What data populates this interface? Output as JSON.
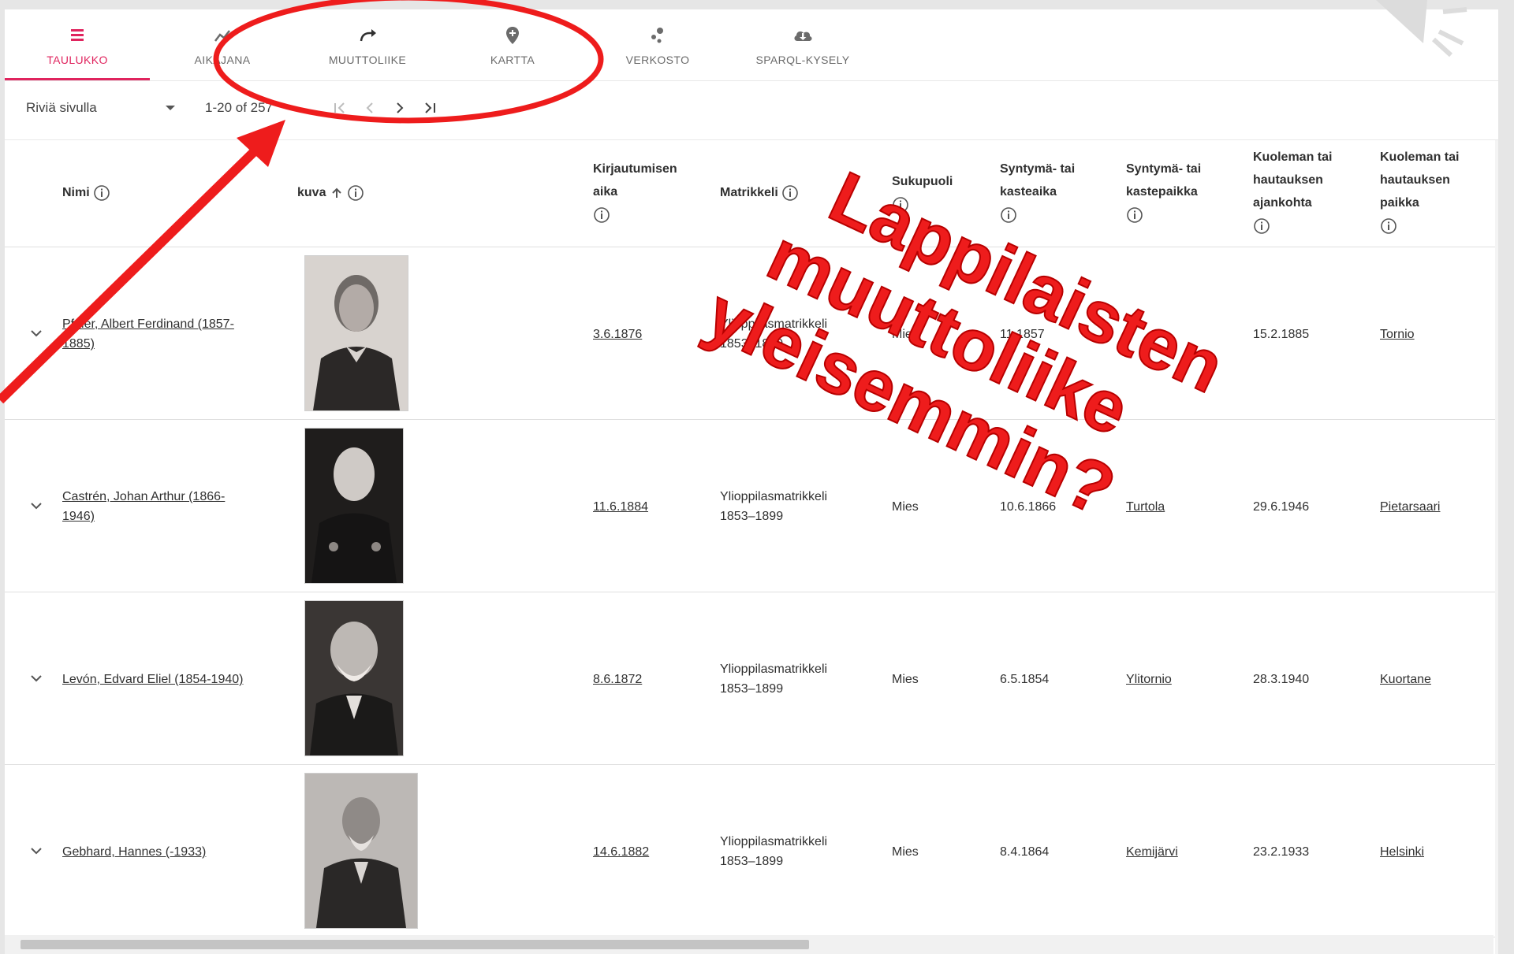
{
  "tabs": [
    {
      "label": "TAULUKKO",
      "icon": "table-icon",
      "active": true
    },
    {
      "label": "AIKAJANA",
      "icon": "timeline-icon",
      "active": false
    },
    {
      "label": "MUUTTOLIIKE",
      "icon": "redo-arrow-icon",
      "active": false
    },
    {
      "label": "KARTTA",
      "icon": "map-pin-plus-icon",
      "active": false
    },
    {
      "label": "VERKOSTO",
      "icon": "network-icon",
      "active": false
    },
    {
      "label": "SPARQL-KYSELY",
      "icon": "cloud-download-icon",
      "active": false
    }
  ],
  "pager": {
    "rows_label": "Riviä sivulla",
    "range": "1-20 of 257"
  },
  "headers": {
    "nimi": "Nimi",
    "kuva": "kuva",
    "kirjautumisen_1": "Kirjautumisen",
    "kirjautumisen_2": "aika",
    "matrikkeli": "Matrikkeli",
    "sukupuoli": "Sukupuoli",
    "syntyma_aika_1": "Syntymä- tai",
    "syntyma_aika_2": "kasteaika",
    "syntyma_paikka_1": "Syntymä- tai",
    "syntyma_paikka_2": "kastepaikka",
    "kuolema_aika_1": "Kuoleman tai",
    "kuolema_aika_2": "hautauksen",
    "kuolema_aika_3": "ajankohta",
    "kuolema_paikka_1": "Kuoleman tai",
    "kuolema_paikka_2": "hautauksen",
    "kuolema_paikka_3": "paikka"
  },
  "rows": [
    {
      "name_1": "Pfaler, Albert Ferdinand (1857-",
      "name_2": "1885)",
      "date": "3.6.1876",
      "matrikkeli_1": "Ylioppilasmatrikkeli",
      "matrikkeli_2": "1853–1899",
      "gender": "Mies",
      "birth": "11.1857",
      "birthplace": "",
      "death": "15.2.1885",
      "deathplace": "Tornio"
    },
    {
      "name_1": "Castrén, Johan Arthur (1866-",
      "name_2": "1946)",
      "date": "11.6.1884",
      "matrikkeli_1": "Ylioppilasmatrikkeli",
      "matrikkeli_2": "1853–1899",
      "gender": "Mies",
      "birth": "10.6.1866",
      "birthplace": "Turtola",
      "death": "29.6.1946",
      "deathplace": "Pietarsaari"
    },
    {
      "name_1": "Levón, Edvard Eliel (1854-1940)",
      "name_2": "",
      "date": "8.6.1872",
      "matrikkeli_1": "Ylioppilasmatrikkeli",
      "matrikkeli_2": "1853–1899",
      "gender": "Mies",
      "birth": "6.5.1854",
      "birthplace": "Ylitornio",
      "death": "28.3.1940",
      "deathplace": "Kuortane"
    },
    {
      "name_1": "Gebhard, Hannes (-1933)",
      "name_2": "",
      "date": "14.6.1882",
      "matrikkeli_1": "Ylioppilasmatrikkeli",
      "matrikkeli_2": "1853–1899",
      "gender": "Mies",
      "birth": "8.4.1864",
      "birthplace": "Kemijärvi",
      "death": "23.2.1933",
      "deathplace": "Helsinki"
    }
  ],
  "annotation": {
    "line_1": "Lappilaisten",
    "line_2": "muuttoliike",
    "line_3": "yleisemmin?",
    "color": "#ee1c1c"
  },
  "accent_color": "#e0245e"
}
